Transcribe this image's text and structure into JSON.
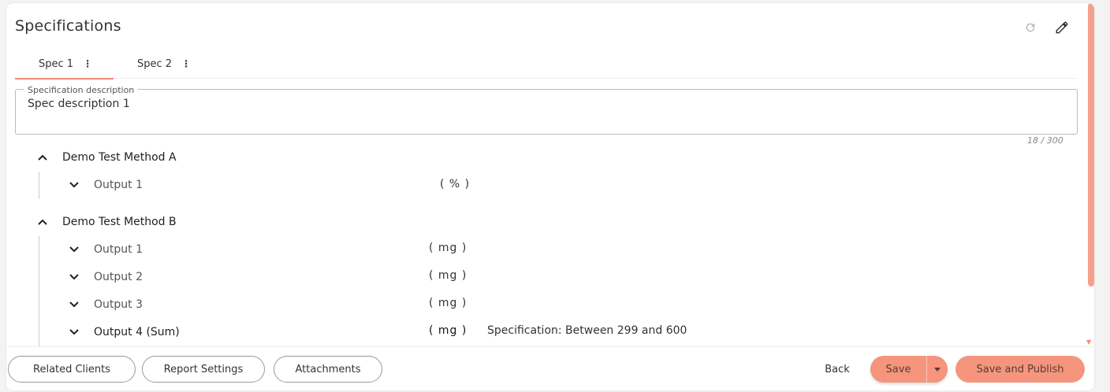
{
  "header": {
    "title": "Specifications"
  },
  "tabs": [
    {
      "label": "Spec 1",
      "active": true
    },
    {
      "label": "Spec 2",
      "active": false
    }
  ],
  "description": {
    "label": "Specification description",
    "value": "Spec description 1",
    "counter": "18 / 300"
  },
  "methods": [
    {
      "name": "Demo Test Method A",
      "outputs": [
        {
          "name": "Output 1",
          "unit": "( % )",
          "spec": ""
        }
      ]
    },
    {
      "name": "Demo Test Method B",
      "outputs": [
        {
          "name": "Output 1",
          "unit": "( mg )",
          "spec": ""
        },
        {
          "name": "Output 2",
          "unit": "( mg )",
          "spec": ""
        },
        {
          "name": "Output 3",
          "unit": "( mg )",
          "spec": ""
        },
        {
          "name": "Output 4 (Sum)",
          "unit": "( mg )",
          "spec": "Specification: Between 299 and 600"
        }
      ]
    }
  ],
  "footer": {
    "related_clients": "Related Clients",
    "report_settings": "Report Settings",
    "attachments": "Attachments",
    "back": "Back",
    "save": "Save",
    "save_publish": "Save and Publish"
  },
  "colors": {
    "accent": "#f5957d",
    "tab_underline": "#f08c72"
  },
  "icons": [
    "refresh-icon",
    "pencil-icon",
    "more-vert-icon",
    "chevron-up-icon",
    "chevron-down-icon",
    "caret-down-icon"
  ]
}
